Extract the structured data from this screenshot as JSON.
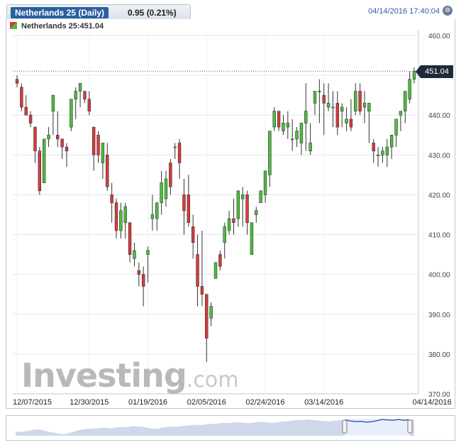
{
  "header": {
    "title": "Netherlands 25 (Daily)",
    "change": "0.95 (0.21%)",
    "timestamp": "04/14/2016 17:40:04"
  },
  "legend": {
    "label": "Netherlands 25:451.04"
  },
  "last_price": "451.04",
  "watermark": {
    "brand": "Investing",
    "suffix": ".com"
  },
  "colors": {
    "up": "#4bbf3a",
    "down": "#d63b3b",
    "accent": "#2b5f9e",
    "navigator": "#3a5fc4"
  },
  "chart_data": {
    "type": "candlestick",
    "ylim": [
      370,
      460
    ],
    "y_ticks": [
      "460.00",
      "450.00",
      "440.00",
      "430.00",
      "420.00",
      "410.00",
      "400.00",
      "390.00",
      "380.00",
      "370.00"
    ],
    "x_ticks": [
      {
        "label": "12/07/2015",
        "index": 0
      },
      {
        "label": "12/30/2015",
        "index": 16
      },
      {
        "label": "01/19/2016",
        "index": 29
      },
      {
        "label": "02/05/2016",
        "index": 42
      },
      {
        "label": "02/24/2016",
        "index": 55
      },
      {
        "label": "03/14/2016",
        "index": 68
      },
      {
        "label": "04/14/2016",
        "index": 90
      }
    ],
    "candles": [
      [
        449,
        450,
        447,
        448
      ],
      [
        447,
        448,
        441,
        442
      ],
      [
        442,
        445,
        440,
        440
      ],
      [
        440,
        441,
        437,
        438
      ],
      [
        437,
        437,
        428,
        431
      ],
      [
        431,
        432,
        420,
        421
      ],
      [
        423,
        434,
        423,
        434
      ],
      [
        434,
        437,
        432,
        435
      ],
      [
        441,
        441,
        435,
        445
      ],
      [
        435,
        441,
        432,
        434
      ],
      [
        434,
        434,
        429,
        432
      ],
      [
        432,
        433,
        427,
        431
      ],
      [
        437,
        444,
        436,
        444
      ],
      [
        444,
        447,
        439,
        446
      ],
      [
        446,
        448,
        442,
        448
      ],
      [
        446,
        446,
        443,
        444
      ],
      [
        444,
        446,
        440,
        441
      ],
      [
        437,
        437,
        426,
        430
      ],
      [
        435,
        436,
        428,
        430
      ],
      [
        428,
        431,
        424,
        433
      ],
      [
        430,
        433,
        421,
        422
      ],
      [
        420,
        423,
        413,
        418
      ],
      [
        418,
        419,
        409,
        411
      ],
      [
        411,
        418,
        409,
        416
      ],
      [
        413,
        418,
        409,
        417
      ],
      [
        413,
        413,
        403,
        405
      ],
      [
        404,
        408,
        402,
        406
      ],
      [
        401,
        403,
        397,
        400
      ],
      [
        400,
        402,
        392,
        397
      ],
      [
        405,
        407,
        398,
        406
      ],
      [
        414,
        420,
        411,
        415
      ],
      [
        414,
        418,
        411,
        418
      ],
      [
        418,
        426,
        415,
        423
      ],
      [
        419,
        426,
        417,
        424
      ],
      [
        428,
        429,
        420,
        422
      ],
      [
        432,
        433,
        429,
        432
      ],
      [
        433,
        434,
        424,
        428
      ],
      [
        420,
        424,
        410,
        416
      ],
      [
        420,
        425,
        412,
        413
      ],
      [
        412,
        415,
        404,
        408
      ],
      [
        405,
        410,
        392,
        397
      ],
      [
        397,
        411,
        392,
        395
      ],
      [
        395,
        395,
        378,
        384
      ],
      [
        389,
        393,
        387,
        392
      ],
      [
        399,
        403,
        399,
        403
      ],
      [
        405,
        406,
        401,
        402
      ],
      [
        408,
        413,
        404,
        412
      ],
      [
        411,
        416,
        410,
        414
      ],
      [
        414,
        419,
        410,
        413
      ],
      [
        414,
        420,
        412,
        421
      ],
      [
        419,
        422,
        412,
        420
      ],
      [
        420,
        421,
        410,
        413
      ],
      [
        405,
        412,
        405,
        413
      ],
      [
        415,
        417,
        413,
        416
      ],
      [
        418,
        419,
        418,
        421
      ],
      [
        420,
        423,
        418,
        426
      ],
      [
        425,
        426,
        422,
        436
      ],
      [
        437,
        442,
        436,
        441
      ],
      [
        441,
        441,
        436,
        437
      ],
      [
        436,
        440,
        435,
        438
      ],
      [
        437,
        441,
        434,
        438
      ],
      [
        434,
        439,
        431,
        434
      ],
      [
        434,
        437,
        432,
        436
      ],
      [
        433,
        437,
        430,
        438
      ],
      [
        438,
        448,
        431,
        441
      ],
      [
        431,
        438,
        430,
        433
      ],
      [
        443,
        446,
        440,
        446
      ],
      [
        446,
        449,
        438,
        446
      ],
      [
        445,
        448,
        435,
        443
      ],
      [
        442,
        448,
        441,
        443
      ],
      [
        442,
        446,
        437,
        442
      ],
      [
        443,
        446,
        435,
        437
      ],
      [
        441,
        443,
        437,
        442
      ],
      [
        438,
        442,
        436,
        439
      ],
      [
        439,
        444,
        436,
        437
      ],
      [
        441,
        448,
        440,
        446
      ],
      [
        446,
        448,
        440,
        441
      ],
      [
        442,
        446,
        438,
        443
      ],
      [
        441,
        443,
        433,
        443
      ],
      [
        433,
        434,
        428,
        431
      ],
      [
        430,
        432,
        427,
        430
      ],
      [
        430,
        432,
        428,
        431
      ],
      [
        430,
        434,
        427,
        432
      ],
      [
        432,
        434,
        429,
        435
      ],
      [
        435,
        437,
        432,
        439
      ],
      [
        440,
        441,
        436,
        441
      ],
      [
        441,
        445,
        438,
        446
      ],
      [
        444,
        451,
        443,
        449
      ],
      [
        449,
        452,
        448,
        451
      ]
    ]
  },
  "navigator": {
    "series": [
      420,
      418,
      421,
      423,
      425,
      424,
      419,
      417,
      414,
      412,
      415,
      419,
      424,
      426,
      427,
      428,
      429,
      430,
      428,
      431,
      432,
      431,
      434,
      433,
      432,
      429,
      427,
      428,
      431,
      433,
      432,
      434,
      435,
      436,
      438,
      437,
      439,
      440,
      441,
      443,
      442,
      444,
      445,
      443,
      442,
      444,
      446,
      445,
      443,
      444,
      446,
      447,
      449,
      451,
      450,
      452,
      451,
      449,
      448,
      447,
      449,
      450,
      451,
      448,
      446,
      447,
      445,
      446,
      449,
      452,
      451,
      450,
      452,
      450,
      451,
      452
    ]
  }
}
